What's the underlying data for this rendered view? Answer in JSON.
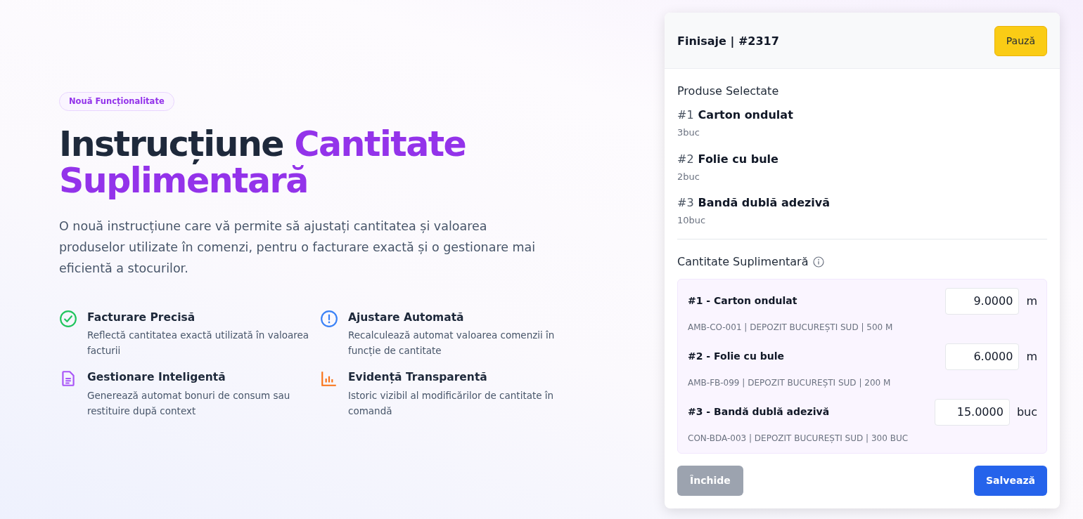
{
  "hero": {
    "badge": "Nouă Funcționalitate",
    "title_plain": "Instrucțiune",
    "title_accent": "Cantitate Suplimentară",
    "description": "O nouă instrucțiune care vă permite să ajustați cantitatea și valoarea produselor utilizate în comenzi, pentru o facturare exactă și o gestionare mai eficientă a stocurilor."
  },
  "features": [
    {
      "kind": "check",
      "title": "Facturare Precisă",
      "text": "Reflectă cantitatea exactă utilizată în valoarea facturii"
    },
    {
      "kind": "alert",
      "title": "Ajustare Automată",
      "text": "Recalculează automat valoarea comenzii în funcție de cantitate"
    },
    {
      "kind": "document",
      "title": "Gestionare Inteligentă",
      "text": "Generează automat bonuri de consum sau restituire după context"
    },
    {
      "kind": "chart",
      "title": "Evidență Transparentă",
      "text": "Istoric vizibil al modificărilor de cantitate în comandă"
    }
  ],
  "panel": {
    "title": "Finisaje | #2317",
    "pause_button": "Pauză",
    "selected_heading": "Produse Selectate",
    "products": [
      {
        "index": "#1",
        "name": "Carton ondulat",
        "quantity": "3buc"
      },
      {
        "index": "#2",
        "name": "Folie cu bule",
        "quantity": "2buc"
      },
      {
        "index": "#3",
        "name": "Bandă dublă adezivă",
        "quantity": "10buc"
      }
    ],
    "extra_heading": "Cantitate Suplimentară",
    "extra_items": [
      {
        "label": "#1 - Carton ondulat",
        "value": "9.0000",
        "unit": "m",
        "details": "AMB-CO-001 | DEPOZIT BUCUREȘTI SUD | 500 M"
      },
      {
        "label": "#2 - Folie cu bule",
        "value": "6.0000",
        "unit": "m",
        "details": "AMB-FB-099 | DEPOZIT BUCUREȘTI SUD | 200 M"
      },
      {
        "label": "#3 - Bandă dublă adezivă",
        "value": "15.0000",
        "unit": "buc",
        "details": "CON-BDA-003 | DEPOZIT BUCUREȘTI SUD | 300 BUC"
      }
    ],
    "close_button": "Închide",
    "save_button": "Salvează"
  }
}
